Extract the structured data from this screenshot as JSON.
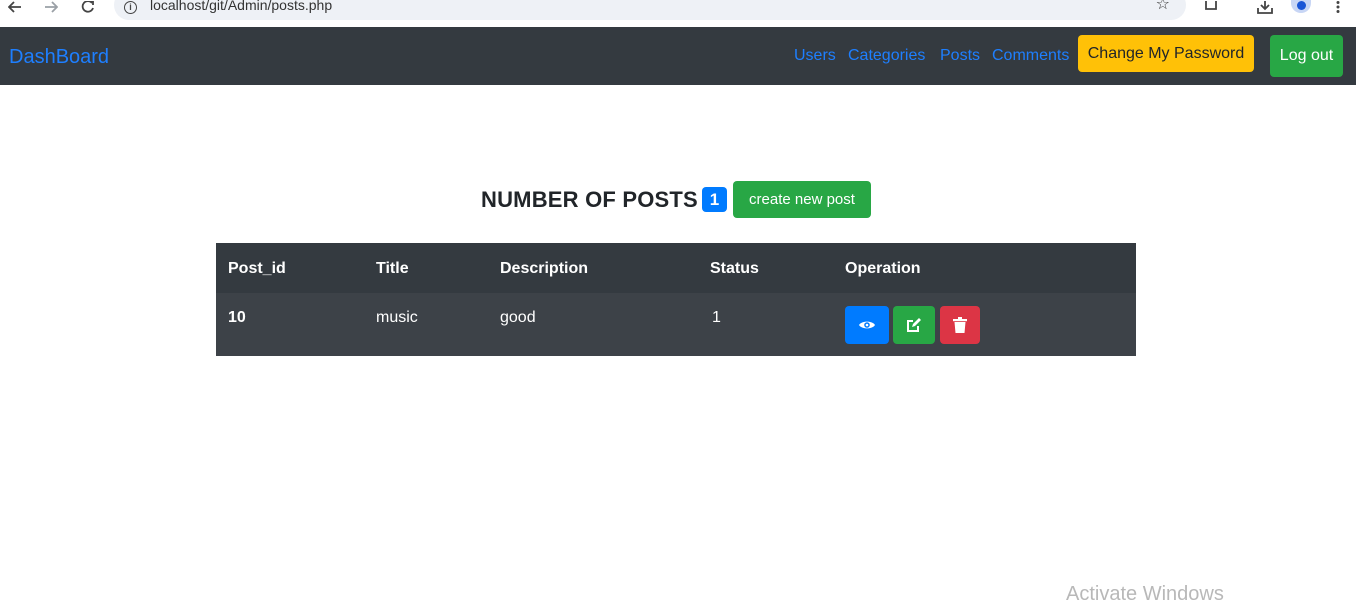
{
  "browser": {
    "url": "localhost/git/Admin/posts.php",
    "icons": [
      "back-icon",
      "forward-icon",
      "reload-icon",
      "info-icon",
      "star-icon",
      "extensions-icon",
      "download-icon",
      "profile-icon",
      "menu-icon"
    ]
  },
  "navbar": {
    "brand": "DashBoard",
    "links": [
      "Users",
      "Categories",
      "Posts",
      "Comments"
    ],
    "change_password": "Change My Password",
    "logout": "Log out"
  },
  "heading": {
    "title": "NUMBER OF POSTS",
    "count": "1",
    "create_button": "create new post"
  },
  "table": {
    "columns": [
      "Post_id",
      "Title",
      "Description",
      "Status",
      "Operation"
    ],
    "rows": [
      {
        "post_id": "10",
        "title": "music",
        "description": "good",
        "status": "1",
        "operations": [
          "view-icon",
          "edit-icon",
          "delete-icon"
        ]
      }
    ]
  },
  "colors": {
    "navbar_bg": "#343a40",
    "link": "#1e7fff",
    "warning": "#ffc107",
    "success": "#28a745",
    "primary": "#007bff",
    "danger": "#dc3545"
  },
  "watermark": "Activate Windows"
}
